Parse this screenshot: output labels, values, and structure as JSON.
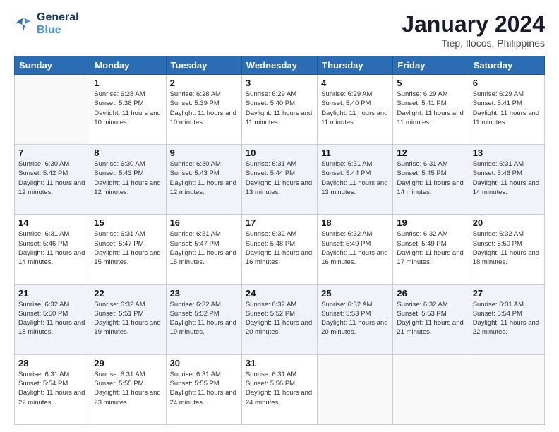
{
  "logo": {
    "line1": "General",
    "line2": "Blue"
  },
  "title": "January 2024",
  "location": "Tiep, Ilocos, Philippines",
  "headers": [
    "Sunday",
    "Monday",
    "Tuesday",
    "Wednesday",
    "Thursday",
    "Friday",
    "Saturday"
  ],
  "weeks": [
    [
      {
        "day": "",
        "sunrise": "",
        "sunset": "",
        "daylight": ""
      },
      {
        "day": "1",
        "sunrise": "Sunrise: 6:28 AM",
        "sunset": "Sunset: 5:38 PM",
        "daylight": "Daylight: 11 hours and 10 minutes."
      },
      {
        "day": "2",
        "sunrise": "Sunrise: 6:28 AM",
        "sunset": "Sunset: 5:39 PM",
        "daylight": "Daylight: 11 hours and 10 minutes."
      },
      {
        "day": "3",
        "sunrise": "Sunrise: 6:29 AM",
        "sunset": "Sunset: 5:40 PM",
        "daylight": "Daylight: 11 hours and 11 minutes."
      },
      {
        "day": "4",
        "sunrise": "Sunrise: 6:29 AM",
        "sunset": "Sunset: 5:40 PM",
        "daylight": "Daylight: 11 hours and 11 minutes."
      },
      {
        "day": "5",
        "sunrise": "Sunrise: 6:29 AM",
        "sunset": "Sunset: 5:41 PM",
        "daylight": "Daylight: 11 hours and 11 minutes."
      },
      {
        "day": "6",
        "sunrise": "Sunrise: 6:29 AM",
        "sunset": "Sunset: 5:41 PM",
        "daylight": "Daylight: 11 hours and 11 minutes."
      }
    ],
    [
      {
        "day": "7",
        "sunrise": "Sunrise: 6:30 AM",
        "sunset": "Sunset: 5:42 PM",
        "daylight": "Daylight: 11 hours and 12 minutes."
      },
      {
        "day": "8",
        "sunrise": "Sunrise: 6:30 AM",
        "sunset": "Sunset: 5:43 PM",
        "daylight": "Daylight: 11 hours and 12 minutes."
      },
      {
        "day": "9",
        "sunrise": "Sunrise: 6:30 AM",
        "sunset": "Sunset: 5:43 PM",
        "daylight": "Daylight: 11 hours and 12 minutes."
      },
      {
        "day": "10",
        "sunrise": "Sunrise: 6:31 AM",
        "sunset": "Sunset: 5:44 PM",
        "daylight": "Daylight: 11 hours and 13 minutes."
      },
      {
        "day": "11",
        "sunrise": "Sunrise: 6:31 AM",
        "sunset": "Sunset: 5:44 PM",
        "daylight": "Daylight: 11 hours and 13 minutes."
      },
      {
        "day": "12",
        "sunrise": "Sunrise: 6:31 AM",
        "sunset": "Sunset: 5:45 PM",
        "daylight": "Daylight: 11 hours and 14 minutes."
      },
      {
        "day": "13",
        "sunrise": "Sunrise: 6:31 AM",
        "sunset": "Sunset: 5:46 PM",
        "daylight": "Daylight: 11 hours and 14 minutes."
      }
    ],
    [
      {
        "day": "14",
        "sunrise": "Sunrise: 6:31 AM",
        "sunset": "Sunset: 5:46 PM",
        "daylight": "Daylight: 11 hours and 14 minutes."
      },
      {
        "day": "15",
        "sunrise": "Sunrise: 6:31 AM",
        "sunset": "Sunset: 5:47 PM",
        "daylight": "Daylight: 11 hours and 15 minutes."
      },
      {
        "day": "16",
        "sunrise": "Sunrise: 6:31 AM",
        "sunset": "Sunset: 5:47 PM",
        "daylight": "Daylight: 11 hours and 15 minutes."
      },
      {
        "day": "17",
        "sunrise": "Sunrise: 6:32 AM",
        "sunset": "Sunset: 5:48 PM",
        "daylight": "Daylight: 11 hours and 16 minutes."
      },
      {
        "day": "18",
        "sunrise": "Sunrise: 6:32 AM",
        "sunset": "Sunset: 5:49 PM",
        "daylight": "Daylight: 11 hours and 16 minutes."
      },
      {
        "day": "19",
        "sunrise": "Sunrise: 6:32 AM",
        "sunset": "Sunset: 5:49 PM",
        "daylight": "Daylight: 11 hours and 17 minutes."
      },
      {
        "day": "20",
        "sunrise": "Sunrise: 6:32 AM",
        "sunset": "Sunset: 5:50 PM",
        "daylight": "Daylight: 11 hours and 18 minutes."
      }
    ],
    [
      {
        "day": "21",
        "sunrise": "Sunrise: 6:32 AM",
        "sunset": "Sunset: 5:50 PM",
        "daylight": "Daylight: 11 hours and 18 minutes."
      },
      {
        "day": "22",
        "sunrise": "Sunrise: 6:32 AM",
        "sunset": "Sunset: 5:51 PM",
        "daylight": "Daylight: 11 hours and 19 minutes."
      },
      {
        "day": "23",
        "sunrise": "Sunrise: 6:32 AM",
        "sunset": "Sunset: 5:52 PM",
        "daylight": "Daylight: 11 hours and 19 minutes."
      },
      {
        "day": "24",
        "sunrise": "Sunrise: 6:32 AM",
        "sunset": "Sunset: 5:52 PM",
        "daylight": "Daylight: 11 hours and 20 minutes."
      },
      {
        "day": "25",
        "sunrise": "Sunrise: 6:32 AM",
        "sunset": "Sunset: 5:53 PM",
        "daylight": "Daylight: 11 hours and 20 minutes."
      },
      {
        "day": "26",
        "sunrise": "Sunrise: 6:32 AM",
        "sunset": "Sunset: 5:53 PM",
        "daylight": "Daylight: 11 hours and 21 minutes."
      },
      {
        "day": "27",
        "sunrise": "Sunrise: 6:31 AM",
        "sunset": "Sunset: 5:54 PM",
        "daylight": "Daylight: 11 hours and 22 minutes."
      }
    ],
    [
      {
        "day": "28",
        "sunrise": "Sunrise: 6:31 AM",
        "sunset": "Sunset: 5:54 PM",
        "daylight": "Daylight: 11 hours and 22 minutes."
      },
      {
        "day": "29",
        "sunrise": "Sunrise: 6:31 AM",
        "sunset": "Sunset: 5:55 PM",
        "daylight": "Daylight: 11 hours and 23 minutes."
      },
      {
        "day": "30",
        "sunrise": "Sunrise: 6:31 AM",
        "sunset": "Sunset: 5:55 PM",
        "daylight": "Daylight: 11 hours and 24 minutes."
      },
      {
        "day": "31",
        "sunrise": "Sunrise: 6:31 AM",
        "sunset": "Sunset: 5:56 PM",
        "daylight": "Daylight: 11 hours and 24 minutes."
      },
      {
        "day": "",
        "sunrise": "",
        "sunset": "",
        "daylight": ""
      },
      {
        "day": "",
        "sunrise": "",
        "sunset": "",
        "daylight": ""
      },
      {
        "day": "",
        "sunrise": "",
        "sunset": "",
        "daylight": ""
      }
    ]
  ]
}
